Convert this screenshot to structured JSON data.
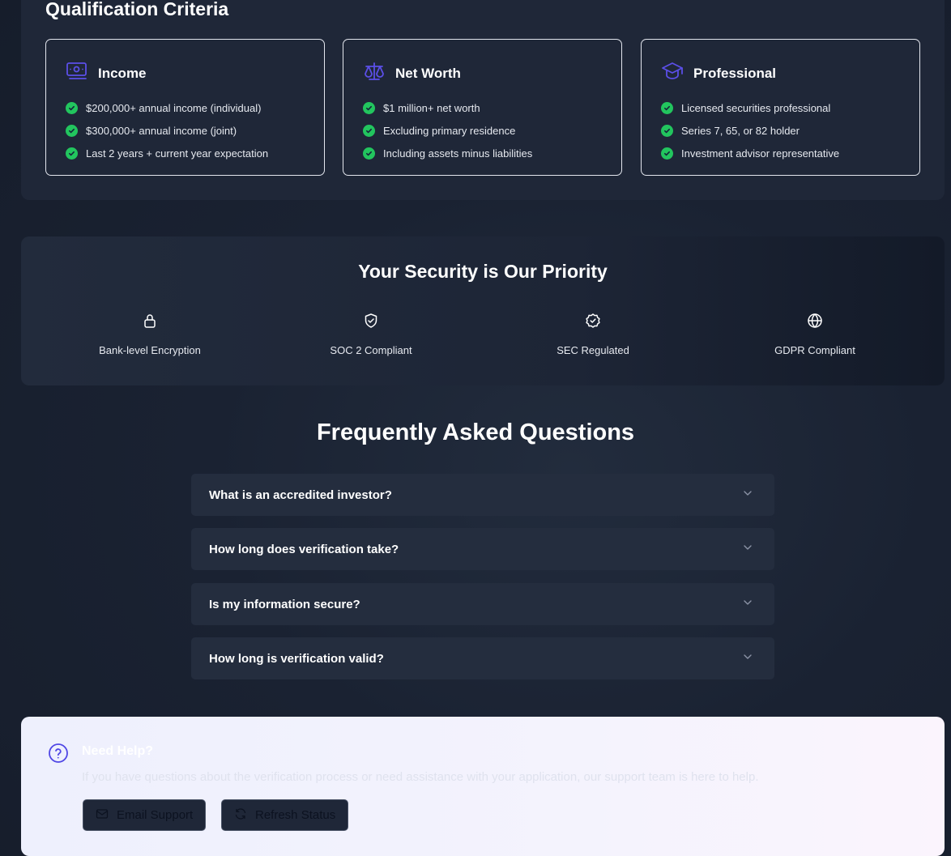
{
  "criteria": {
    "title": "Qualification Criteria",
    "cards": [
      {
        "icon": "money-icon",
        "title": "Income",
        "items": [
          "$200,000+ annual income (individual)",
          "$300,000+ annual income (joint)",
          "Last 2 years + current year expectation"
        ]
      },
      {
        "icon": "scale-icon",
        "title": "Net Worth",
        "items": [
          "$1 million+ net worth",
          "Excluding primary residence",
          "Including assets minus liabilities"
        ]
      },
      {
        "icon": "graduation-cap-icon",
        "title": "Professional",
        "items": [
          "Licensed securities professional",
          "Series 7, 65, or 82 holder",
          "Investment advisor representative"
        ]
      }
    ]
  },
  "security": {
    "title": "Your Security is Our Priority",
    "features": [
      {
        "icon": "lock-icon",
        "label": "Bank-level Encryption"
      },
      {
        "icon": "shield-check-icon",
        "label": "SOC 2 Compliant"
      },
      {
        "icon": "badge-check-icon",
        "label": "SEC Regulated"
      },
      {
        "icon": "globe-icon",
        "label": "GDPR Compliant"
      }
    ]
  },
  "faq": {
    "title": "Frequently Asked Questions",
    "items": [
      {
        "question": "What is an accredited investor?"
      },
      {
        "question": "How long does verification take?"
      },
      {
        "question": "Is my information secure?"
      },
      {
        "question": "How long is verification valid?"
      }
    ]
  },
  "help": {
    "icon": "help-circle-icon",
    "title": "Need Help?",
    "text": "If you have questions about the verification process or need assistance with your application, our support team is here to help.",
    "email_button": "Email Support",
    "refresh_button": "Refresh Status"
  },
  "colors": {
    "accent": "#5b4fe8",
    "check": "#22c55e",
    "panel": "#1f2738"
  }
}
